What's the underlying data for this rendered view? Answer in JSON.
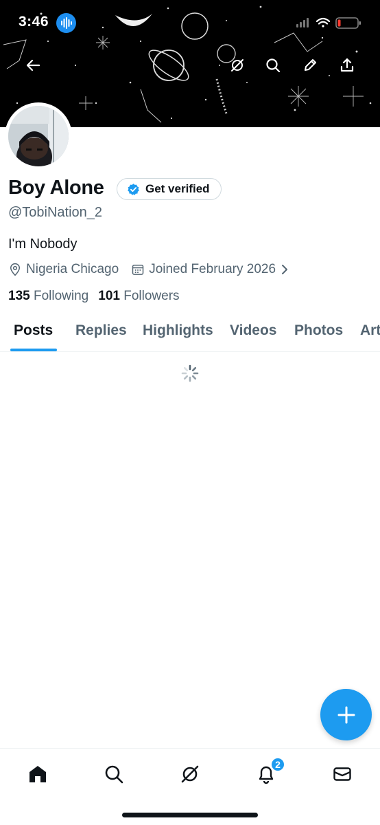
{
  "status_bar": {
    "time": "3:46"
  },
  "profile": {
    "display_name": "Boy Alone",
    "verify_label": "Get verified",
    "handle": "@TobiNation_2",
    "bio": "I'm Nobody",
    "location": "Nigeria Chicago",
    "joined": "Joined February 2026",
    "following_count": "135",
    "following_label": "Following",
    "followers_count": "101",
    "followers_label": "Followers"
  },
  "tabs": [
    {
      "label": "Posts"
    },
    {
      "label": "Replies"
    },
    {
      "label": "Highlights"
    },
    {
      "label": "Videos"
    },
    {
      "label": "Photos"
    },
    {
      "label": "Articles"
    }
  ],
  "nav": {
    "items": [
      "home-icon",
      "search-icon",
      "grok-icon",
      "bell-icon",
      "mail-icon"
    ],
    "notification_badge": "2"
  },
  "colors": {
    "accent": "#1d9bf0",
    "text_primary": "#0f1419",
    "text_secondary": "#536471"
  }
}
